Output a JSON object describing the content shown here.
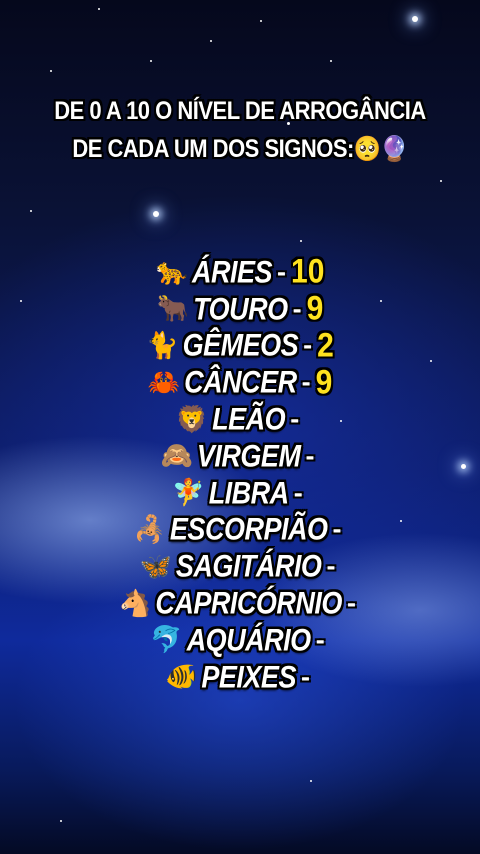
{
  "heading": {
    "line1": "DE 0 A 10 O NÍVEL DE ARROGÂNCIA",
    "line2": "DE CADA UM DOS SIGNOS:",
    "emoji1": "🥺",
    "emoji2": "🔮"
  },
  "signs": [
    {
      "emoji": "🐆",
      "name": "ÁRIES",
      "dash": "-",
      "score": "10"
    },
    {
      "emoji": "🐂",
      "name": "TOURO",
      "dash": "-",
      "score": "9"
    },
    {
      "emoji": "🐈",
      "name": "GÊMEOS",
      "dash": "-",
      "score": "2"
    },
    {
      "emoji": "🦀",
      "name": "CÂNCER",
      "dash": "-",
      "score": "9"
    },
    {
      "emoji": "🦁",
      "name": "LEÃO",
      "dash": "-",
      "score": ""
    },
    {
      "emoji": "🙈",
      "name": "VIRGEM",
      "dash": "-",
      "score": ""
    },
    {
      "emoji": "🧚",
      "name": "LIBRA",
      "dash": "-",
      "score": ""
    },
    {
      "emoji": "🦂",
      "name": "ESCORPIÃO",
      "dash": "-",
      "score": ""
    },
    {
      "emoji": "🦋",
      "name": "SAGITÁRIO",
      "dash": "-",
      "score": ""
    },
    {
      "emoji": "🐴",
      "name": "CAPRICÓRNIO",
      "dash": "-",
      "score": ""
    },
    {
      "emoji": "🐬",
      "name": "AQUÁRIO",
      "dash": "-",
      "score": ""
    },
    {
      "emoji": "🐠",
      "name": "PEIXES",
      "dash": "-",
      "score": ""
    }
  ],
  "colors": {
    "text": "#ffffff",
    "score": "#ffe21f",
    "outline": "#000000",
    "sky_top": "#05081c",
    "sky_mid": "#0f2a9c"
  }
}
